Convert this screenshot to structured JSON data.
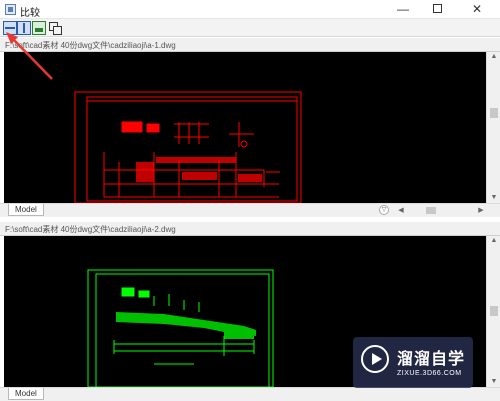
{
  "window": {
    "title": "比较",
    "minimize_glyph": "—",
    "close_glyph": "✕"
  },
  "toolbar": {
    "buttons": [
      {
        "name": "split-horizontal-icon"
      },
      {
        "name": "split-vertical-icon"
      },
      {
        "name": "image-compare-icon"
      },
      {
        "name": "overlay-compare-icon"
      }
    ]
  },
  "annotation": {
    "color": "#e53935"
  },
  "panes": [
    {
      "path": "F:\\soft\\cad素材 40份dwg文件\\cadziliaoji\\a-1.dwg",
      "tab": "Model",
      "drawing_color": "#ff0000"
    },
    {
      "path": "F:\\soft\\cad素材 40份dwg文件\\cadziliaoji\\a-2.dwg",
      "tab": "Model",
      "drawing_color": "#00ff00"
    }
  ],
  "scroll": {
    "up": "▲",
    "down": "▼",
    "left": "◀",
    "right": "▶",
    "tab_menu": "▽"
  },
  "watermark": {
    "name": "溜溜自学",
    "url": "ZIXUE.3D66.COM"
  }
}
